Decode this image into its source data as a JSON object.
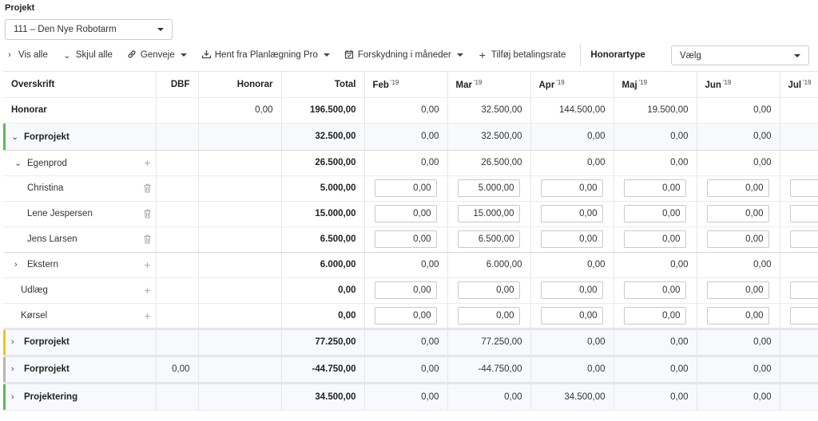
{
  "project": {
    "label": "Projekt",
    "selected": "111 – Den Nye Robotarm"
  },
  "toolbar": {
    "show_all": "Vis alle",
    "hide_all": "Skjul alle",
    "shortcuts": "Genveje",
    "fetch": "Hent fra Planlægning Pro",
    "shift": "Forskydning i måneder",
    "add_rate": "Tilføj betalingsrate",
    "fee_type_label": "Honorartype",
    "fee_type_value": "Vælg"
  },
  "columns": {
    "heading": "Overskrift",
    "dbf": "DBF",
    "fee": "Honorar",
    "total": "Total",
    "year_sup": "'19",
    "months": [
      "Feb",
      "Mar",
      "Apr",
      "Maj",
      "Jun",
      "Jul"
    ]
  },
  "rows": [
    {
      "name": "Honorar",
      "dbf": "",
      "fee": "0,00",
      "total": "196.500,00",
      "months": [
        "0,00",
        "32.500,00",
        "144.500,00",
        "19.500,00",
        "0,00",
        ""
      ]
    },
    {
      "name": "Forprojekt",
      "dbf": "",
      "fee": "",
      "total": "32.500,00",
      "months": [
        "0,00",
        "32.500,00",
        "0,00",
        "0,00",
        "0,00",
        ""
      ]
    },
    {
      "name": "Egenprod",
      "total": "26.500,00",
      "months": [
        "0,00",
        "26.500,00",
        "0,00",
        "0,00",
        "0,00",
        ""
      ]
    },
    {
      "name": "Christina",
      "total": "5.000,00",
      "months": [
        "0,00",
        "5.000,00",
        "0,00",
        "0,00",
        "0,00",
        ""
      ]
    },
    {
      "name": "Lene Jespersen",
      "total": "15.000,00",
      "months": [
        "0,00",
        "15.000,00",
        "0,00",
        "0,00",
        "0,00",
        ""
      ]
    },
    {
      "name": "Jens Larsen",
      "total": "6.500,00",
      "months": [
        "0,00",
        "6.500,00",
        "0,00",
        "0,00",
        "0,00",
        ""
      ]
    },
    {
      "name": "Ekstern",
      "total": "6.000,00",
      "months": [
        "0,00",
        "6.000,00",
        "0,00",
        "0,00",
        "0,00",
        ""
      ]
    },
    {
      "name": "Udlæg",
      "total": "0,00",
      "months": [
        "0,00",
        "0,00",
        "0,00",
        "0,00",
        "0,00",
        ""
      ]
    },
    {
      "name": "Kørsel",
      "total": "0,00",
      "months": [
        "0,00",
        "0,00",
        "0,00",
        "0,00",
        "0,00",
        ""
      ]
    },
    {
      "name": "Forprojekt",
      "dbf": "",
      "total": "77.250,00",
      "months": [
        "0,00",
        "77.250,00",
        "0,00",
        "0,00",
        "0,00",
        ""
      ]
    },
    {
      "name": "Forprojekt",
      "dbf": "0,00",
      "total": "-44.750,00",
      "months": [
        "0,00",
        "-44.750,00",
        "0,00",
        "0,00",
        "0,00",
        ""
      ]
    },
    {
      "name": "Projektering",
      "dbf": "",
      "total": "34.500,00",
      "months": [
        "0,00",
        "0,00",
        "34.500,00",
        "0,00",
        "0,00",
        ""
      ]
    }
  ],
  "colors": {
    "green": "#5cb85c",
    "yellow": "#f0c419",
    "gray": "#b5b5b5"
  }
}
